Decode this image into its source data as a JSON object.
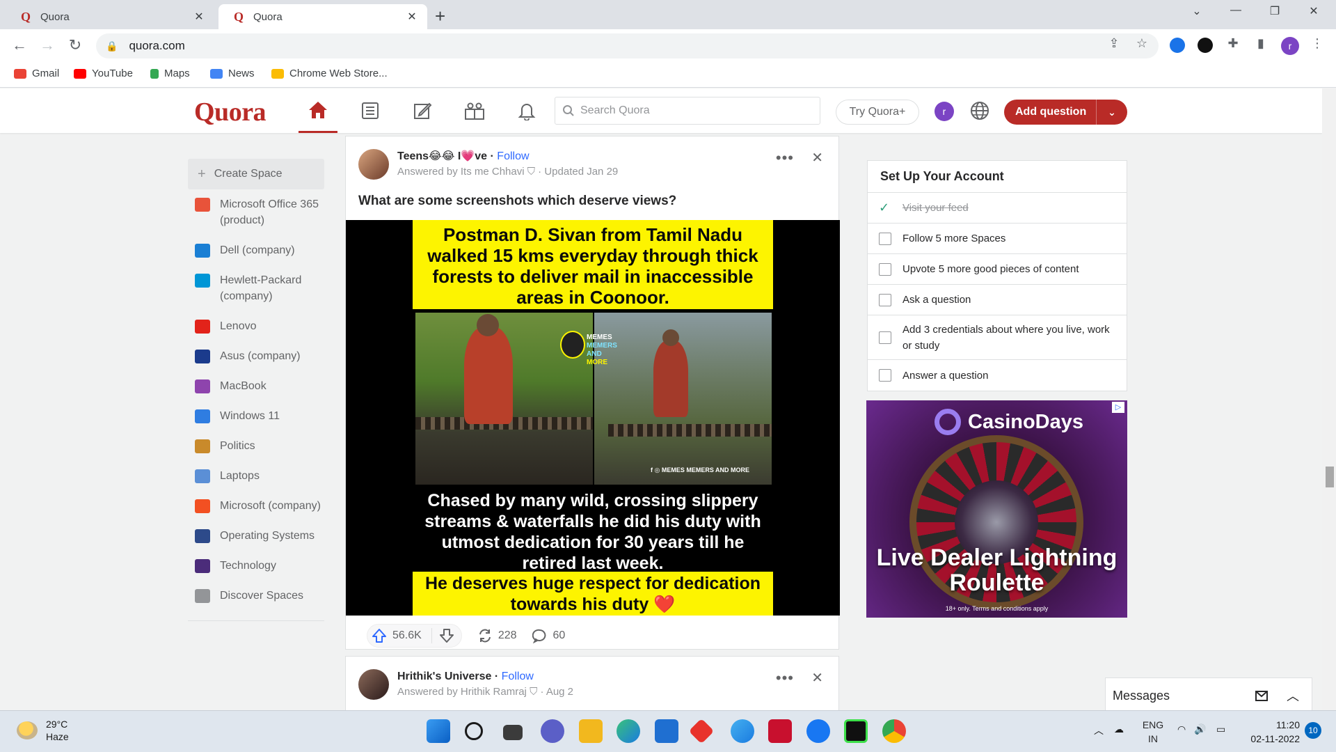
{
  "browser": {
    "tabs": [
      {
        "title": "Quora",
        "active": false
      },
      {
        "title": "Quora",
        "active": true
      }
    ],
    "url": "quora.com",
    "bookmarks": [
      "Gmail",
      "YouTube",
      "Maps",
      "News",
      "Chrome Web Store..."
    ],
    "profile_initial": "r"
  },
  "header": {
    "logo": "Quora",
    "search_placeholder": "Search Quora",
    "try_plus": "Try Quora+",
    "avatar_initial": "r",
    "add_question": "Add question"
  },
  "sidebar": {
    "create_space": "Create Space",
    "items": [
      {
        "label": "Microsoft Office 365 (product)",
        "color": "#e8533a"
      },
      {
        "label": "Dell (company)",
        "color": "#1a7fd4"
      },
      {
        "label": "Hewlett-Packard (company)",
        "color": "#0096d6"
      },
      {
        "label": "Lenovo",
        "color": "#e2231a"
      },
      {
        "label": "Asus (company)",
        "color": "#1b3b8c"
      },
      {
        "label": "MacBook",
        "color": "#8e44ad"
      },
      {
        "label": "Windows 11",
        "color": "#2f7de1"
      },
      {
        "label": "Politics",
        "color": "#c98a2b"
      },
      {
        "label": "Laptops",
        "color": "#5b8fd6"
      },
      {
        "label": "Microsoft (company)",
        "color": "#f25022"
      },
      {
        "label": "Operating Systems",
        "color": "#2d4a8a"
      },
      {
        "label": "Technology",
        "color": "#4b2c7a"
      },
      {
        "label": "Discover Spaces",
        "color": "#939598"
      }
    ]
  },
  "post": {
    "space": "Teens😂😂 I💗ve",
    "follow": "Follow",
    "answered_by": "Answered by Its me Chhavi",
    "updated": "· Updated Jan 29",
    "question": "What are some screenshots which deserve views?",
    "image_text_top": "Postman D. Sivan from Tamil Nadu walked 15 kms everyday through thick forests to deliver mail in inaccessible areas in Coonoor.",
    "image_text_middle": "Chased by many wild, crossing slippery streams & waterfalls he did his duty with utmost dedication for 30 years till he retired last week.",
    "image_text_bottom": "He deserves huge respect for dedication towards his duty ❤️",
    "badge_line1": "MEMES",
    "badge_line2": "MEMERS AND",
    "badge_line3": "MORE",
    "watermark": "f ◎ MEMES MEMERS AND MORE",
    "upvotes": "56.6K",
    "shares": "228",
    "comments": "60"
  },
  "post2": {
    "space": "Hrithik's Universe",
    "follow": "Follow",
    "answered_by": "Answered by Hrithik Ramraj",
    "updated": "· Aug 2"
  },
  "setup": {
    "title": "Set Up Your Account",
    "items": [
      {
        "label": "Visit your feed",
        "done": true
      },
      {
        "label": "Follow 5 more Spaces",
        "done": false
      },
      {
        "label": "Upvote 5 more good pieces of content",
        "done": false
      },
      {
        "label": "Ask a question",
        "done": false
      },
      {
        "label": "Add 3 credentials about where you live, work or study",
        "done": false
      },
      {
        "label": "Answer a question",
        "done": false
      }
    ]
  },
  "ad": {
    "brand": "CasinoDays",
    "headline": "Live Dealer Lightning Roulette",
    "disclaimer": "18+ only. Terms and conditions apply"
  },
  "messages": {
    "label": "Messages"
  },
  "taskbar": {
    "temperature": "29°C",
    "condition": "Haze",
    "lang_top": "ENG",
    "lang_bottom": "IN",
    "time": "11:20",
    "date": "02-11-2022",
    "notifications": "10"
  },
  "colors": {
    "quora_red": "#b92b27",
    "link_blue": "#2e69ff",
    "ad_purple": "#3a1245"
  }
}
